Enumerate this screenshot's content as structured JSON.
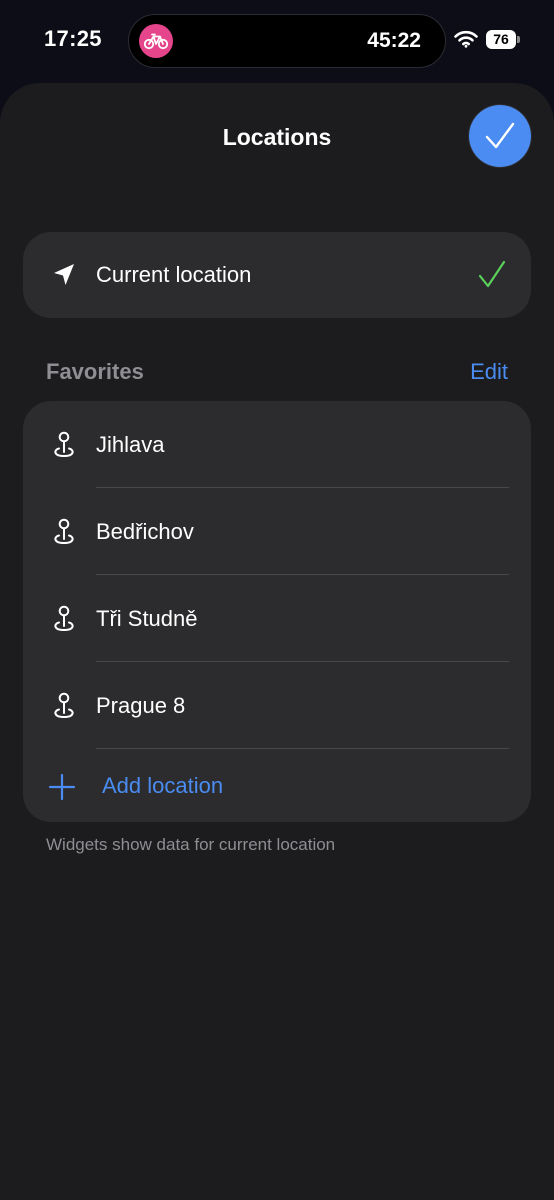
{
  "status_bar": {
    "time": "17:25",
    "activity_timer": "45:22",
    "battery_level": "76",
    "activity_app_icon": "bicycle-icon",
    "activity_app_color": "#e5468b"
  },
  "header": {
    "title": "Locations",
    "done_icon": "checkmark-icon"
  },
  "current_location": {
    "icon": "location-arrow-icon",
    "label": "Current location",
    "selected": true,
    "check_color": "#5ad15a"
  },
  "favorites": {
    "section_label": "Favorites",
    "edit_label": "Edit",
    "items": [
      {
        "icon": "map-pin-icon",
        "label": "Jihlava"
      },
      {
        "icon": "map-pin-icon",
        "label": "Bedřichov"
      },
      {
        "icon": "map-pin-icon",
        "label": "Tři Studně"
      },
      {
        "icon": "map-pin-icon",
        "label": "Prague 8"
      }
    ],
    "add_label": "Add location",
    "add_icon": "plus-icon"
  },
  "footnote": "Widgets show data for current location",
  "colors": {
    "accent": "#4a8cf1",
    "background": "#1c1c1e",
    "card": "#2c2c2e",
    "secondary_text": "#8e8e93"
  }
}
